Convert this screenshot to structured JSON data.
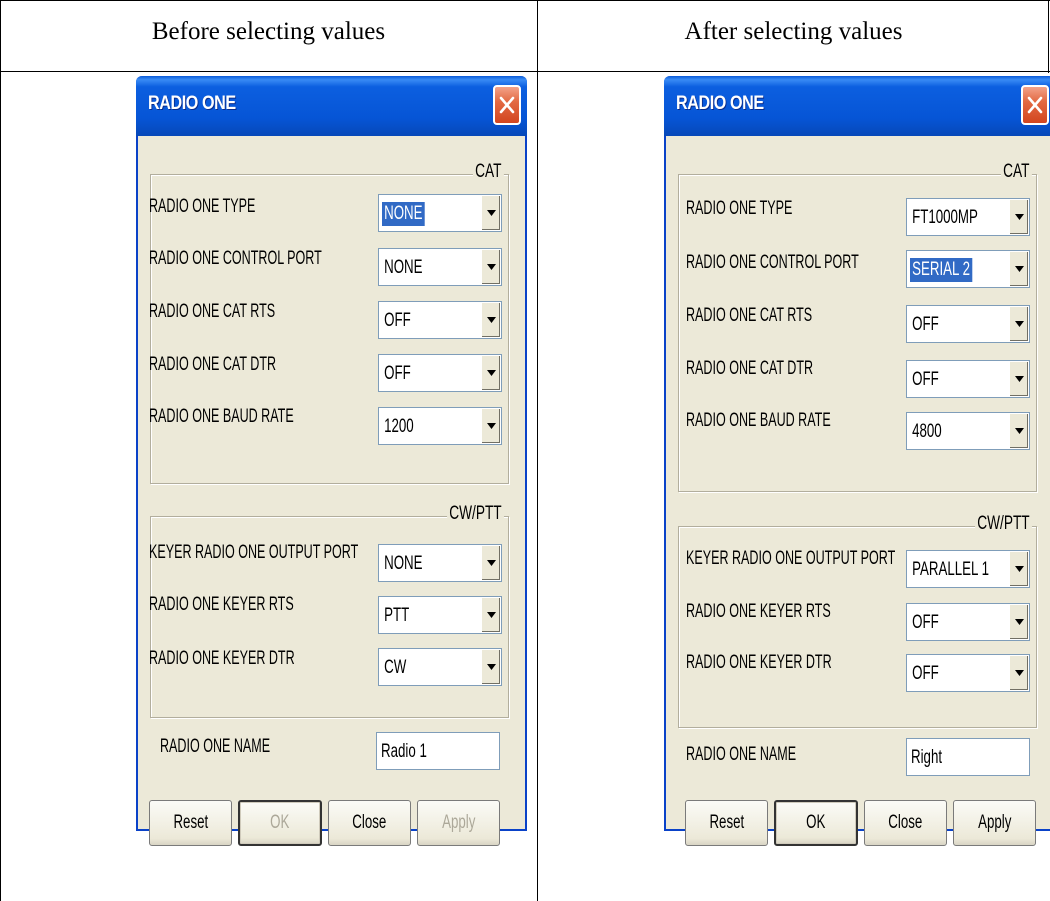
{
  "table": {
    "left_header": "Before selecting values",
    "right_header": "After selecting values"
  },
  "icons": {
    "close": "close-x-icon",
    "dropdown": "chevron-down-icon"
  },
  "colors": {
    "titlebar": "#0655d6",
    "dialog_bg": "#ece9d8",
    "selection": "#316ac5",
    "close_button": "#e36a44"
  },
  "labels": {
    "cat_group": "CAT",
    "cwptt_group": "CW/PTT",
    "type": "RADIO ONE TYPE",
    "control_port": "RADIO ONE CONTROL PORT",
    "cat_rts": "RADIO ONE CAT RTS",
    "cat_dtr": "RADIO ONE CAT DTR",
    "baud_rate": "RADIO ONE BAUD RATE",
    "keyer_output_port": "KEYER RADIO ONE OUTPUT PORT",
    "keyer_rts": "RADIO ONE KEYER RTS",
    "keyer_dtr": "RADIO ONE KEYER DTR",
    "name": "RADIO ONE NAME"
  },
  "before": {
    "title": "RADIO ONE",
    "type": "NONE",
    "control_port": "NONE",
    "cat_rts": "OFF",
    "cat_dtr": "OFF",
    "baud_rate": "1200",
    "keyer_output_port": "NONE",
    "keyer_rts": "PTT",
    "keyer_dtr": "CW",
    "name": "Radio 1",
    "buttons": {
      "reset": "Reset",
      "ok": "OK",
      "close": "Close",
      "apply": "Apply"
    }
  },
  "after": {
    "title": "RADIO ONE",
    "type": "FT1000MP",
    "control_port": "SERIAL 2",
    "cat_rts": "OFF",
    "cat_dtr": "OFF",
    "baud_rate": "4800",
    "keyer_output_port": "PARALLEL 1",
    "keyer_rts": "OFF",
    "keyer_dtr": "OFF",
    "name": "Right",
    "buttons": {
      "reset": "Reset",
      "ok": "OK",
      "close": "Close",
      "apply": "Apply"
    }
  }
}
